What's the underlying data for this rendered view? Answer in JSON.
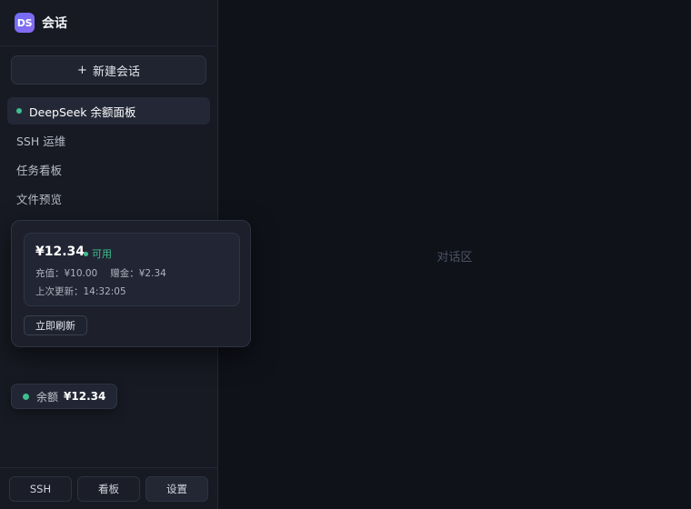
{
  "sidebar": {
    "logo_text": "DS",
    "title": "会话",
    "new_chat": {
      "icon": "+",
      "label": "新建会话"
    },
    "conversations": [
      {
        "label": "DeepSeek 余额面板",
        "active": true
      },
      {
        "label": "SSH 运维"
      },
      {
        "label": "任务看板"
      },
      {
        "label": "文件预览"
      }
    ],
    "footer": {
      "ssh_label": "SSH",
      "board_label": "看板",
      "settings_label": "设置"
    }
  },
  "balance_popover": {
    "amount": "¥12.34",
    "status": "可用",
    "recharge": "充值：¥10.00",
    "gift": "赠金：¥2.34",
    "updated": "上次更新：14:32:05",
    "refresh_label": "立即刷新"
  },
  "balance_chip": {
    "label": "余额",
    "value": "¥12.34"
  },
  "main": {
    "placeholder": "对话区"
  },
  "colors": {
    "accent": "#6f6cf6",
    "status_ok": "#3fbf8f",
    "background": "#10121a",
    "sidebar_bg": "#171a23"
  }
}
